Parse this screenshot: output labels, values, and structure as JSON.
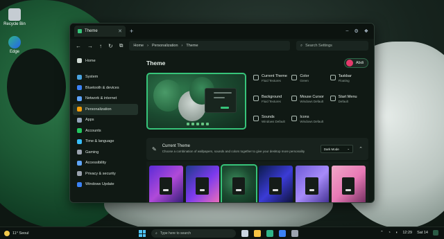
{
  "desktop": {
    "icons": [
      {
        "label": "Recycle Bin",
        "icon": "recycle-bin-icon"
      },
      {
        "label": "Edge",
        "icon": "edge-icon"
      }
    ]
  },
  "window": {
    "tab_title": "Theme",
    "breadcrumb": [
      "Home",
      "Personalization",
      "Theme"
    ],
    "search_placeholder": "Search Settings"
  },
  "sidebar": {
    "items": [
      {
        "label": "Home",
        "icon": "home-icon",
        "color": "#cfd9d3"
      },
      {
        "label": "System",
        "icon": "monitor-icon",
        "color": "#4aa3df"
      },
      {
        "label": "Bluetooth & devices",
        "icon": "bluetooth-icon",
        "color": "#3b82f6"
      },
      {
        "label": "Network & internet",
        "icon": "wifi-icon",
        "color": "#60a5fa"
      },
      {
        "label": "Personalization",
        "icon": "brush-icon",
        "color": "#f59e0b",
        "active": true
      },
      {
        "label": "Apps",
        "icon": "apps-icon",
        "color": "#94a3b8"
      },
      {
        "label": "Accounts",
        "icon": "person-icon",
        "color": "#22c55e"
      },
      {
        "label": "Time & language",
        "icon": "clock-globe-icon",
        "color": "#38bdf8"
      },
      {
        "label": "Gaming",
        "icon": "gamepad-icon",
        "color": "#9ca3af"
      },
      {
        "label": "Accessibility",
        "icon": "accessibility-icon",
        "color": "#60a5fa"
      },
      {
        "label": "Privacy & security",
        "icon": "shield-icon",
        "color": "#9ca3af"
      },
      {
        "label": "Windows Update",
        "icon": "update-icon",
        "color": "#3b82f6"
      }
    ]
  },
  "main": {
    "title": "Theme",
    "user": "Abdi",
    "properties": [
      {
        "title": "Current Theme",
        "value": "Fluid Textures",
        "icon": "brush-icon"
      },
      {
        "title": "Color",
        "value": "Green",
        "icon": "palette-icon"
      },
      {
        "title": "Taskbar",
        "value": "Floating",
        "icon": "taskbar-icon"
      },
      {
        "title": "Background",
        "value": "Fluid Textures",
        "icon": "image-icon"
      },
      {
        "title": "Mouse Cursor",
        "value": "Windows Default",
        "icon": "cursor-icon"
      },
      {
        "title": "Start Menu",
        "value": "Default",
        "icon": "start-menu-icon"
      },
      {
        "title": "Sounds",
        "value": "Windows Default",
        "icon": "speaker-icon"
      },
      {
        "title": "Icons",
        "value": "Windows Default",
        "icon": "grid-icon"
      }
    ],
    "current_theme": {
      "title": "Current Theme",
      "description": "Choose a combination of wallpapers, sounds and colors together to give your desktop more personality",
      "mode": "Dark Mode"
    },
    "themes": [
      {
        "name": "purple-blue",
        "bg": "linear-gradient(135deg,#5b2bd6,#b04ad9,#2a1a6e)"
      },
      {
        "name": "blue-pink",
        "bg": "linear-gradient(135deg,#1e3a8a,#7c3aed,#f472b6)"
      },
      {
        "name": "fluid-green",
        "bg": "radial-gradient(circle at 40% 40%,#3a8a5a,#1b4a30,#0e2a1b)",
        "selected": true
      },
      {
        "name": "deep-blue",
        "bg": "linear-gradient(135deg,#0b1a4a,#3b3bd6,#0a0f2e)"
      },
      {
        "name": "violet",
        "bg": "linear-gradient(135deg,#6d5bd6,#a78bfa,#3b2a8a)"
      },
      {
        "name": "pink-dune",
        "bg": "linear-gradient(135deg,#f0a8c8,#e879b5,#6b2a5a)"
      }
    ]
  },
  "taskbar": {
    "weather": "11° Seoul",
    "search_placeholder": "Type here to search",
    "time": "12:29",
    "date": "Sat 14",
    "apps": [
      {
        "name": "task-view-icon",
        "color": "#cbd5e1"
      },
      {
        "name": "explorer-icon",
        "color": "#f6c344"
      },
      {
        "name": "edge-icon",
        "color": "#2fb58a"
      },
      {
        "name": "store-icon",
        "color": "#3b82f6"
      },
      {
        "name": "settings-icon",
        "color": "#9ca3af"
      }
    ]
  }
}
